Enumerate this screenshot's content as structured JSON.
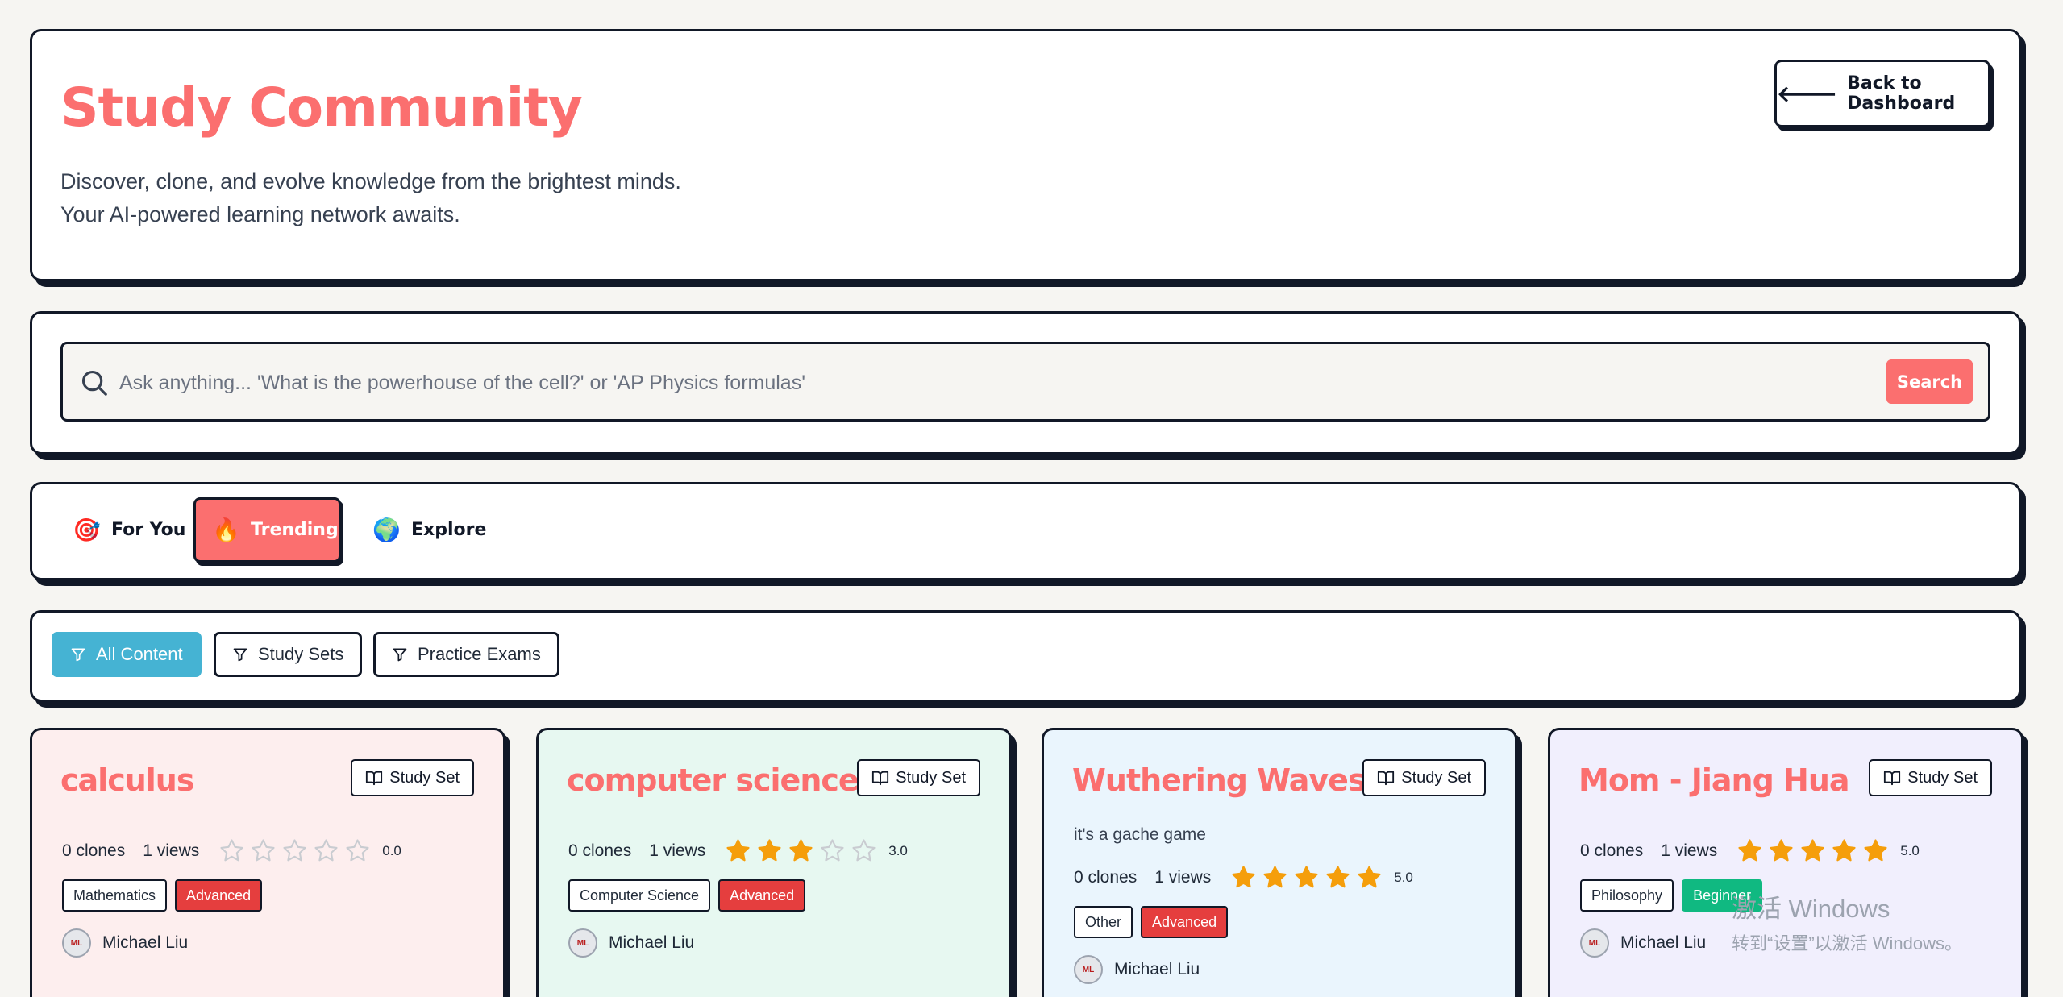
{
  "header": {
    "title": "Study Community",
    "subtitle": "Discover, clone, and evolve knowledge from the brightest minds. Your AI-powered learning network awaits.",
    "back_label": "Back to Dashboard"
  },
  "search": {
    "placeholder": "Ask anything... 'What is the powerhouse of the cell?' or 'AP Physics formulas'",
    "value": "",
    "button_label": "Search"
  },
  "tabs": [
    {
      "label": "For You",
      "emoji": "🎯",
      "active": false
    },
    {
      "label": "Trending",
      "emoji": "🔥",
      "active": true
    },
    {
      "label": "Explore",
      "emoji": "🌍",
      "active": false
    }
  ],
  "filters": [
    {
      "label": "All Content",
      "active": true
    },
    {
      "label": "Study Sets",
      "active": false
    },
    {
      "label": "Practice Exams",
      "active": false
    }
  ],
  "cards": [
    {
      "title": "calculus",
      "type": "Study Set",
      "description": "",
      "clones": "0 clones",
      "views": "1 views",
      "stars": 0,
      "rating": "0.0",
      "subject": "Mathematics",
      "level": "Advanced",
      "author": "Michael Liu",
      "bg": "#fdeeee"
    },
    {
      "title": "computer science",
      "type": "Study Set",
      "description": "",
      "clones": "0 clones",
      "views": "1 views",
      "stars": 3,
      "rating": "3.0",
      "subject": "Computer Science",
      "level": "Advanced",
      "author": "Michael Liu",
      "bg": "#e7f8f1"
    },
    {
      "title": "Wuthering Waves",
      "type": "Study Set",
      "description": "it's a gache game",
      "clones": "0 clones",
      "views": "1 views",
      "stars": 5,
      "rating": "5.0",
      "subject": "Other",
      "level": "Advanced",
      "author": "Michael Liu",
      "bg": "#eaf5fd"
    },
    {
      "title": "Mom - Jiang Hua",
      "type": "Study Set",
      "description": "",
      "clones": "0 clones",
      "views": "1 views",
      "stars": 5,
      "rating": "5.0",
      "subject": "Philosophy",
      "level": "Beginner",
      "author": "Michael Liu",
      "bg": "#f1effd"
    }
  ],
  "watermark": {
    "line1": "激活 Windows",
    "line2": "转到“设置”以激活 Windows。"
  },
  "colors": {
    "accent": "#fb6f6f",
    "filter_active": "#45b3d3",
    "star": "#f59e0b",
    "advanced": "#e53e3e",
    "beginner": "#10b981"
  }
}
